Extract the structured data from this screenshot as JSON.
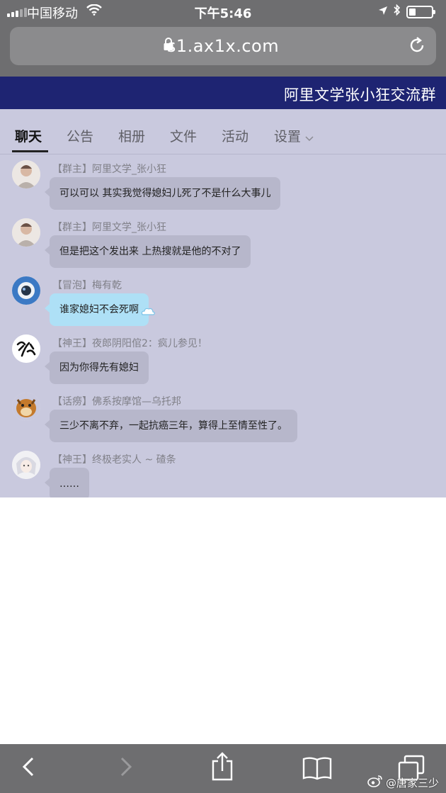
{
  "status_bar": {
    "carrier": "中国移动",
    "time": "下午5:46",
    "battery_level": 0.3
  },
  "browser": {
    "url": "s1.ax1x.com"
  },
  "group": {
    "title": "阿里文学张小狂交流群"
  },
  "tabs": [
    {
      "label": "聊天",
      "active": true
    },
    {
      "label": "公告"
    },
    {
      "label": "相册"
    },
    {
      "label": "文件"
    },
    {
      "label": "活动"
    },
    {
      "label": "设置"
    }
  ],
  "messages": [
    {
      "tag": "【群主】",
      "sender": "阿里文学_张小狂",
      "text": "可以可以  其实我觉得媳妇儿死了不是什么大事儿",
      "avatar_icon": "person-avatar-icon"
    },
    {
      "tag": "【群主】",
      "sender": "阿里文学_张小狂",
      "text": "但是把这个发出来  上热搜就是他的不对了",
      "avatar_icon": "person-avatar-icon"
    },
    {
      "tag": "【冒泡】",
      "sender": "梅有乾",
      "text": "谁家媳妇不会死啊",
      "avatar_icon": "astronaut-avatar-icon",
      "bubble_style": "special"
    },
    {
      "tag": "【神王】",
      "sender": "夜郎阴阳倌2：疯儿参见！",
      "text": "因为你得先有媳妇",
      "avatar_icon": "calligraphy-avatar-icon"
    },
    {
      "tag": "【话痨】",
      "sender": "佛系按摩馆—乌托邦",
      "text": "三少不离不弃，一起抗癌三年，算得上至情至性了。",
      "avatar_icon": "horse-avatar-icon"
    },
    {
      "tag": "【神王】",
      "sender": "终极老实人 ~ 碴条",
      "text": "……",
      "avatar_icon": "anime-avatar-icon"
    }
  ],
  "watermark": {
    "text": "@唐家三少"
  }
}
